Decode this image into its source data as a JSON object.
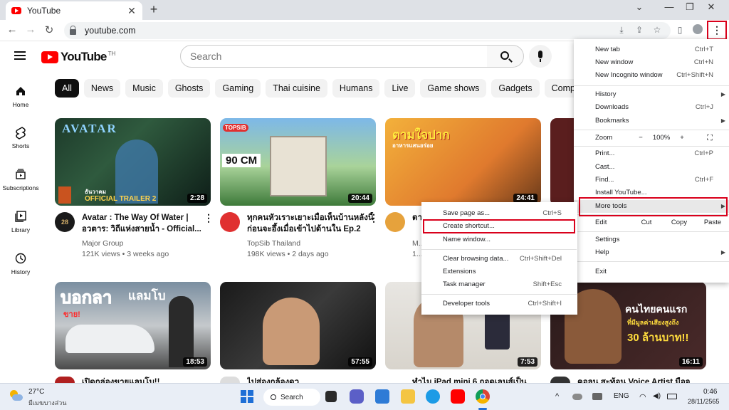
{
  "browser": {
    "tab_title": "YouTube",
    "tab_close": "✕",
    "new_tab": "+",
    "minimize": "⌄",
    "restore": "—",
    "maximize": "❐",
    "close": "✕",
    "back": "←",
    "forward": "→",
    "reload": "↻",
    "url": "youtube.com",
    "kebab": "⋮"
  },
  "youtube": {
    "logo_text": "YouTube",
    "country_code": "TH",
    "search_placeholder": "Search",
    "chips": [
      "All",
      "News",
      "Music",
      "Ghosts",
      "Gaming",
      "Thai cuisine",
      "Humans",
      "Live",
      "Game shows",
      "Gadgets",
      "Compilat"
    ],
    "sidebar": [
      {
        "label": "Home",
        "icon": "home-icon"
      },
      {
        "label": "Shorts",
        "icon": "shorts-icon"
      },
      {
        "label": "Subscriptions",
        "icon": "subscriptions-icon"
      },
      {
        "label": "Library",
        "icon": "library-icon"
      },
      {
        "label": "History",
        "icon": "history-icon"
      }
    ],
    "videos": [
      {
        "title": "Avatar : The Way Of Water | อวตาร: วิถีแห่งสายน้ำ - Official...",
        "channel": "Major Group",
        "meta": "121K views • 3 weeks ago",
        "duration": "2:28",
        "thumb_text": "AVATAR",
        "thumb_sub": "OFFICIAL TRAILER 2",
        "thumb_small": "ธันวาคม"
      },
      {
        "title": "ทุกคนหัวเราะเยาะเมื่อเห็นบ้านหลังนี้ ก่อนจะอึ้งเมื่อเข้าไปด้านใน Ep.2",
        "channel": "TopSib Thailand",
        "meta": "198K views • 2 days ago",
        "duration": "20:44",
        "thumb_text": "90 CM",
        "thumb_logo": "TOPSIB"
      },
      {
        "title": "ตา...",
        "channel": "M...",
        "meta": "1...",
        "duration": "24:41",
        "thumb_text": "ตามใจปาก",
        "thumb_sub": "อาหารแสนอร่อย"
      },
      {
        "title": "",
        "channel": "",
        "meta": "",
        "duration": "",
        "thumb_text": ""
      },
      {
        "title": "เปิดกล่องขายแลมโบ!!",
        "duration": "18:53",
        "thumb_text": "บอกลา",
        "thumb_sub": "แลมโบ",
        "thumb_small": "ขาย!"
      },
      {
        "title": "ไปส่องกล้องดูว...",
        "duration": "57:55",
        "thumb_text": ""
      },
      {
        "title": "ทำไม iPad mini 6 ถอดเลนส์เป็นไง...",
        "duration": "7:53",
        "thumb_text": ""
      },
      {
        "title": "คอลน สะท้อน Voice Artist มือจ...",
        "duration": "16:11",
        "thumb_text": "คนไทยคนแรก",
        "thumb_sub": "ที่มีมูลค่าเสียงสูงถึง",
        "thumb_small": "30 ล้านบาท!!"
      }
    ]
  },
  "chrome_menu": {
    "new_tab": {
      "label": "New tab",
      "shortcut": "Ctrl+T"
    },
    "new_window": {
      "label": "New window",
      "shortcut": "Ctrl+N"
    },
    "new_incognito": {
      "label": "New Incognito window",
      "shortcut": "Ctrl+Shift+N"
    },
    "history": {
      "label": "History"
    },
    "downloads": {
      "label": "Downloads",
      "shortcut": "Ctrl+J"
    },
    "bookmarks": {
      "label": "Bookmarks"
    },
    "zoom": {
      "label": "Zoom",
      "minus": "−",
      "value": "100%",
      "plus": "+",
      "fullscreen": "⛶"
    },
    "print": {
      "label": "Print...",
      "shortcut": "Ctrl+P"
    },
    "cast": {
      "label": "Cast..."
    },
    "find": {
      "label": "Find...",
      "shortcut": "Ctrl+F"
    },
    "install": {
      "label": "Install YouTube..."
    },
    "more_tools": {
      "label": "More tools"
    },
    "edit": {
      "label": "Edit",
      "cut": "Cut",
      "copy": "Copy",
      "paste": "Paste"
    },
    "settings": {
      "label": "Settings"
    },
    "help": {
      "label": "Help"
    },
    "exit": {
      "label": "Exit"
    },
    "arrow": "▶"
  },
  "more_tools_menu": {
    "save_page": {
      "label": "Save page as...",
      "shortcut": "Ctrl+S"
    },
    "create_shortcut": {
      "label": "Create shortcut..."
    },
    "name_window": {
      "label": "Name window..."
    },
    "clear_data": {
      "label": "Clear browsing data...",
      "shortcut": "Ctrl+Shift+Del"
    },
    "extensions": {
      "label": "Extensions"
    },
    "task_manager": {
      "label": "Task manager",
      "shortcut": "Shift+Esc"
    },
    "dev_tools": {
      "label": "Developer tools",
      "shortcut": "Ctrl+Shift+I"
    }
  },
  "taskbar": {
    "weather_temp": "27°C",
    "weather_desc": "มีเมฆบางส่วน",
    "search_label": "Search",
    "language": "ENG",
    "time": "0:46",
    "date": "28/11/2565",
    "tray_arrow": "^"
  },
  "colors": {
    "highlight_red": "#d9001b",
    "youtube_red": "#ff0000"
  }
}
